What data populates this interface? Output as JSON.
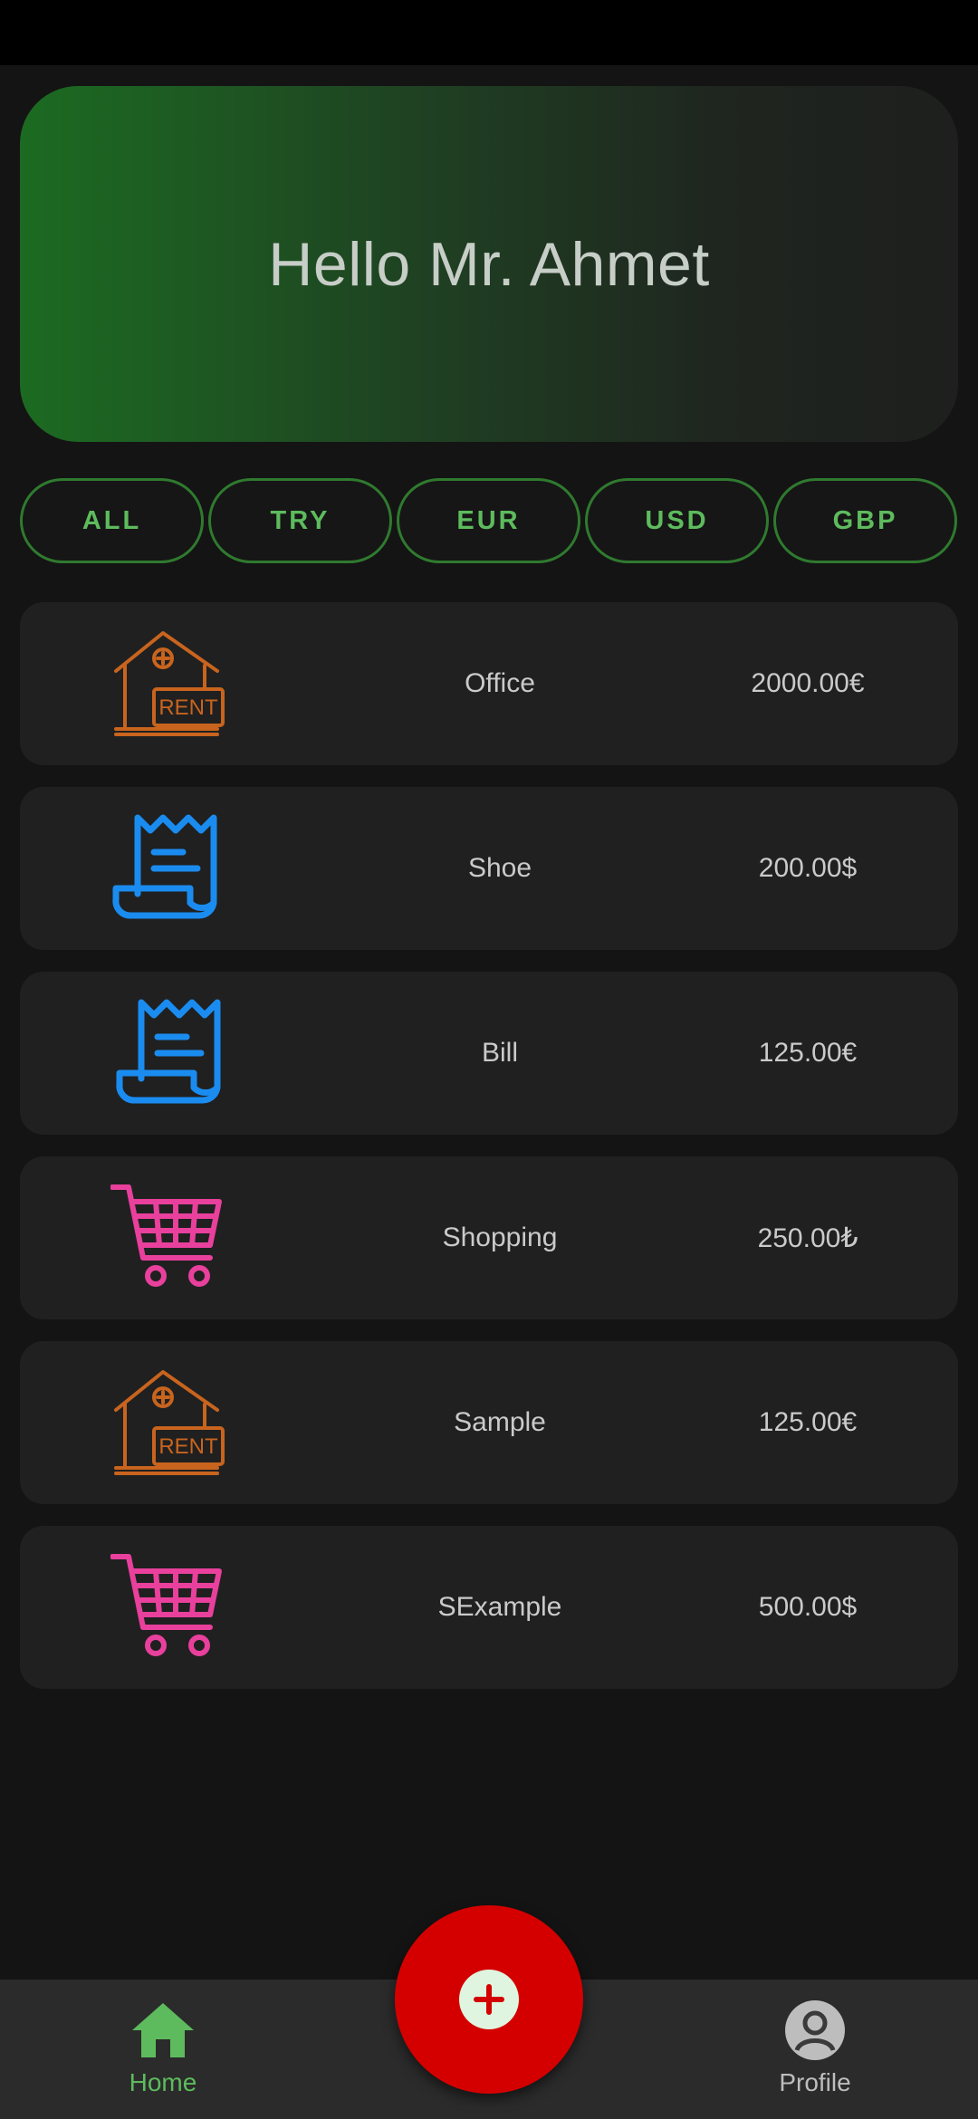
{
  "header": {
    "greeting": "Hello Mr. Ahmet"
  },
  "filters": [
    "ALL",
    "TRY",
    "EUR",
    "USD",
    "GBP"
  ],
  "expenses": [
    {
      "icon": "rent-house-icon",
      "name": "Office",
      "amount": "2000.00€"
    },
    {
      "icon": "receipt-icon",
      "name": "Shoe",
      "amount": "200.00$"
    },
    {
      "icon": "receipt-icon",
      "name": "Bill",
      "amount": "125.00€"
    },
    {
      "icon": "shopping-cart-icon",
      "name": "Shopping",
      "amount": "250.00₺"
    },
    {
      "icon": "rent-house-icon",
      "name": "Sample",
      "amount": "125.00€"
    },
    {
      "icon": "shopping-cart-icon",
      "name": "SExample",
      "amount": "500.00$"
    }
  ],
  "icon_texts": {
    "rent_sign": "RENT"
  },
  "colors": {
    "accent_green": "#5dbb5d",
    "fab_red": "#d40000",
    "rent_icon": "#c8641e",
    "receipt_icon": "#1a8cf0",
    "cart_icon": "#e8409c"
  },
  "nav": {
    "home_label": "Home",
    "profile_label": "Profile"
  }
}
